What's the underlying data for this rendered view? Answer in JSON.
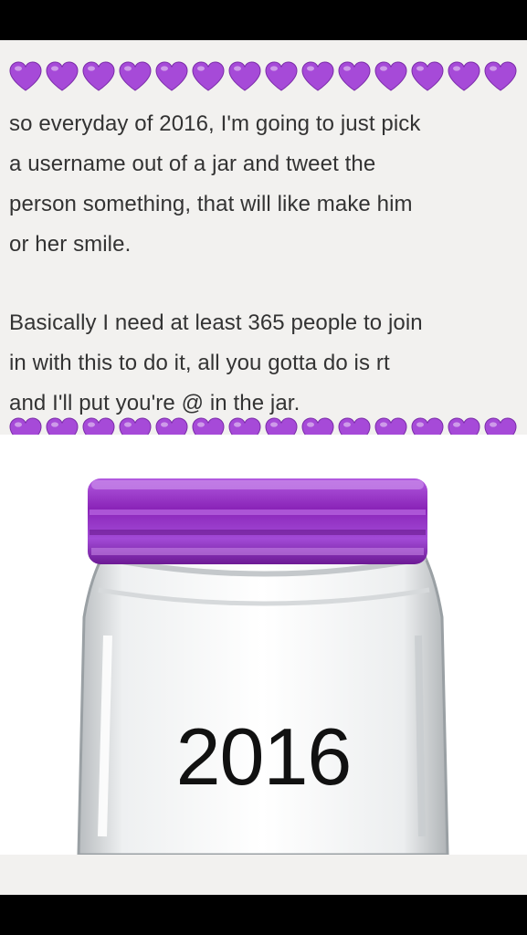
{
  "note": {
    "heart_icon": "purple-heart-icon",
    "heart_color": "#a64ad8",
    "hearts_per_row": 14,
    "paragraph_1": "so everyday of 2016, I'm going to just pick\na username out of a jar and tweet the\nperson something, that will like make him\nor her smile.",
    "paragraph_2": "Basically I need at least 365 people to join\nin with this to do it, all you gotta do is rt\nand I'll put you're @ in the jar."
  },
  "jar": {
    "label": "2016",
    "lid_color": "#8a24b8"
  }
}
